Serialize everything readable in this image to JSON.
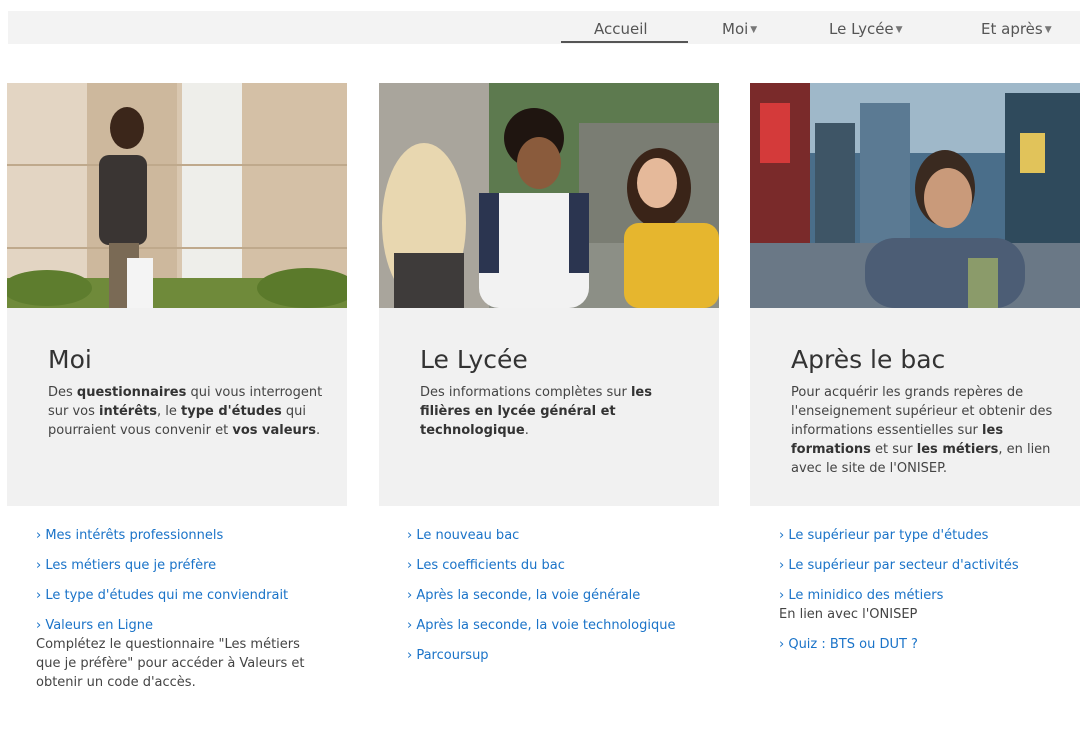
{
  "nav": {
    "items": [
      {
        "label": "Accueil",
        "caret": false
      },
      {
        "label": "Moi",
        "caret": true
      },
      {
        "label": "Le Lycée",
        "caret": true
      },
      {
        "label": "Et après",
        "caret": true
      }
    ]
  },
  "cards": [
    {
      "title": "Moi",
      "desc": [
        {
          "t": "Des ",
          "b": false
        },
        {
          "t": "questionnaires",
          "b": true
        },
        {
          "t": " qui vous interrogent sur vos ",
          "b": false
        },
        {
          "t": "intérêts",
          "b": true
        },
        {
          "t": ", le ",
          "b": false
        },
        {
          "t": "type d'études",
          "b": true
        },
        {
          "t": " qui pourraient vous convenir et ",
          "b": false
        },
        {
          "t": "vos valeurs",
          "b": true
        },
        {
          "t": ".",
          "b": false
        }
      ],
      "links": [
        {
          "label": "› Mes intérêts professionnels",
          "note": ""
        },
        {
          "label": "› Les métiers que je préfère",
          "note": ""
        },
        {
          "label": "› Le type d'études qui me conviendrait",
          "note": ""
        },
        {
          "label": "› Valeurs en Ligne",
          "note": "Complétez le questionnaire \"Les métiers que je préfère\" pour accéder à Valeurs et obtenir un code d'accès."
        }
      ]
    },
    {
      "title": "Le Lycée",
      "desc": [
        {
          "t": "Des informations complètes sur ",
          "b": false
        },
        {
          "t": "les filières en lycée général et technologique",
          "b": true
        },
        {
          "t": ".",
          "b": false
        }
      ],
      "links": [
        {
          "label": "› Le nouveau bac",
          "note": ""
        },
        {
          "label": "› Les coefficients du bac",
          "note": ""
        },
        {
          "label": "› Après la seconde, la voie générale",
          "note": ""
        },
        {
          "label": "› Après la seconde, la voie technologique",
          "note": ""
        },
        {
          "label": "› Parcoursup",
          "note": ""
        }
      ]
    },
    {
      "title": "Après le bac",
      "desc": [
        {
          "t": "Pour acquérir les grands repères de l'enseignement supérieur et obtenir des informations essentielles sur ",
          "b": false
        },
        {
          "t": "les formations",
          "b": true
        },
        {
          "t": " et sur ",
          "b": false
        },
        {
          "t": "les métiers",
          "b": true
        },
        {
          "t": ", en lien avec le site de l'ONISEP.",
          "b": false
        }
      ],
      "links": [
        {
          "label": "› Le supérieur par type d'études",
          "note": ""
        },
        {
          "label": "› Le supérieur par secteur d'activités",
          "note": ""
        },
        {
          "label": "› Le minidico des métiers",
          "note": "En lien avec l'ONISEP"
        },
        {
          "label": "› Quiz : BTS ou DUT ?",
          "note": ""
        }
      ]
    }
  ]
}
